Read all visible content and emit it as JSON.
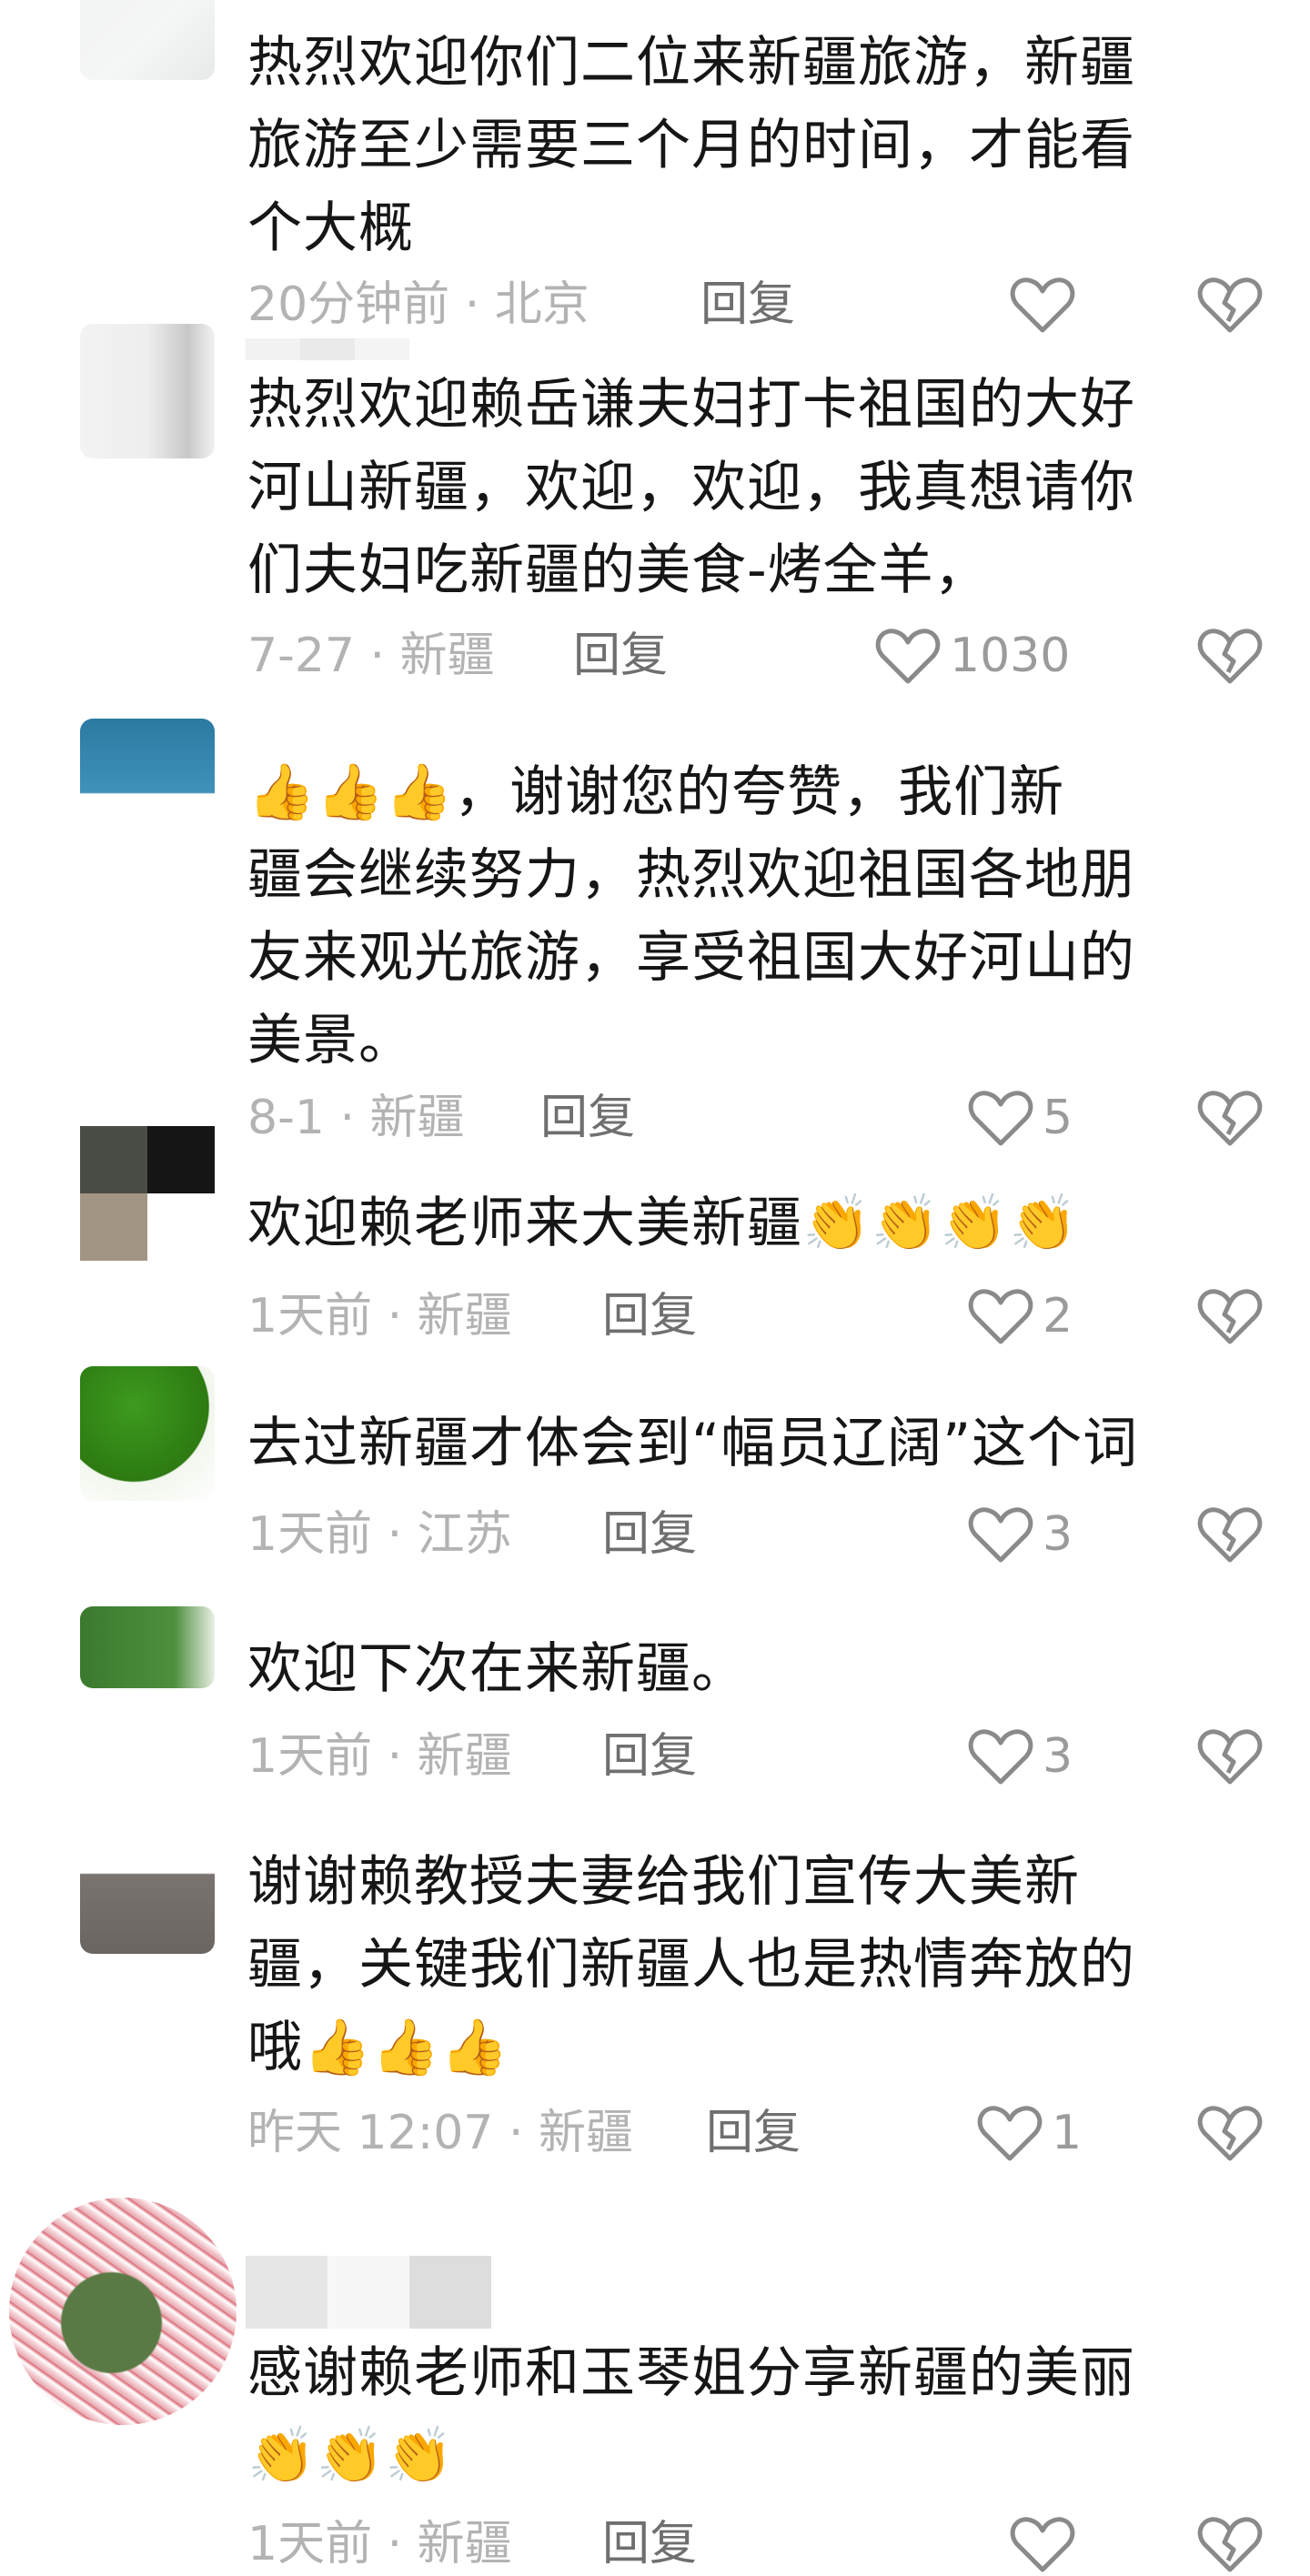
{
  "comments": [
    {
      "text": "热烈欢迎你们二位来新疆旅游，新疆旅游至少需要三个月的时间，才能看个大概",
      "lines": [
        "热烈欢迎你们二位来新疆旅游，新疆",
        "旅游至少需要三个月的时间，才能看",
        "个大概"
      ],
      "time": "20分钟前 · 北京",
      "reply": "回复",
      "likes": ""
    },
    {
      "lines": [
        "热烈欢迎赖岳谦夫妇打卡祖国的大好",
        "河山新疆，欢迎，欢迎，我真想请你",
        "们夫妇吃新疆的美食-烤全羊，"
      ],
      "time": "7-27 · 新疆",
      "reply": "回复",
      "likes": "1030"
    },
    {
      "lines": [
        "👍👍👍，谢谢您的夸赞，我们新",
        "疆会继续努力，热烈欢迎祖国各地朋",
        "友来观光旅游，享受祖国大好河山的",
        "美景。"
      ],
      "time": "8-1 · 新疆",
      "reply": "回复",
      "likes": "5"
    },
    {
      "lines": [
        "欢迎赖老师来大美新疆👏👏👏👏"
      ],
      "time": "1天前 · 新疆",
      "reply": "回复",
      "likes": "2"
    },
    {
      "lines": [
        "去过新疆才体会到“幅员辽阔”这个词"
      ],
      "time": "1天前 · 江苏",
      "reply": "回复",
      "likes": "3"
    },
    {
      "lines": [
        "欢迎下次在来新疆。"
      ],
      "time": "1天前 · 新疆",
      "reply": "回复",
      "likes": "3"
    },
    {
      "lines": [
        "谢谢赖教授夫妻给我们宣传大美新",
        "疆，关键我们新疆人也是热情奔放的",
        "哦👍👍👍"
      ],
      "time": "昨天 12:07 · 新疆",
      "reply": "回复",
      "likes": "1"
    },
    {
      "lines": [
        "感谢赖老师和玉琴姐分享新疆的美丽",
        "👏👏👏"
      ],
      "time": "1天前 · 新疆",
      "reply": "回复",
      "likes": ""
    }
  ],
  "icons": {
    "like": "heart-outline-icon",
    "dislike": "broken-heart-icon"
  },
  "colors": {
    "text": "#161616",
    "meta": "#b3b3b3",
    "reply": "#6f6f6f",
    "icon": "#8a8a8a"
  }
}
